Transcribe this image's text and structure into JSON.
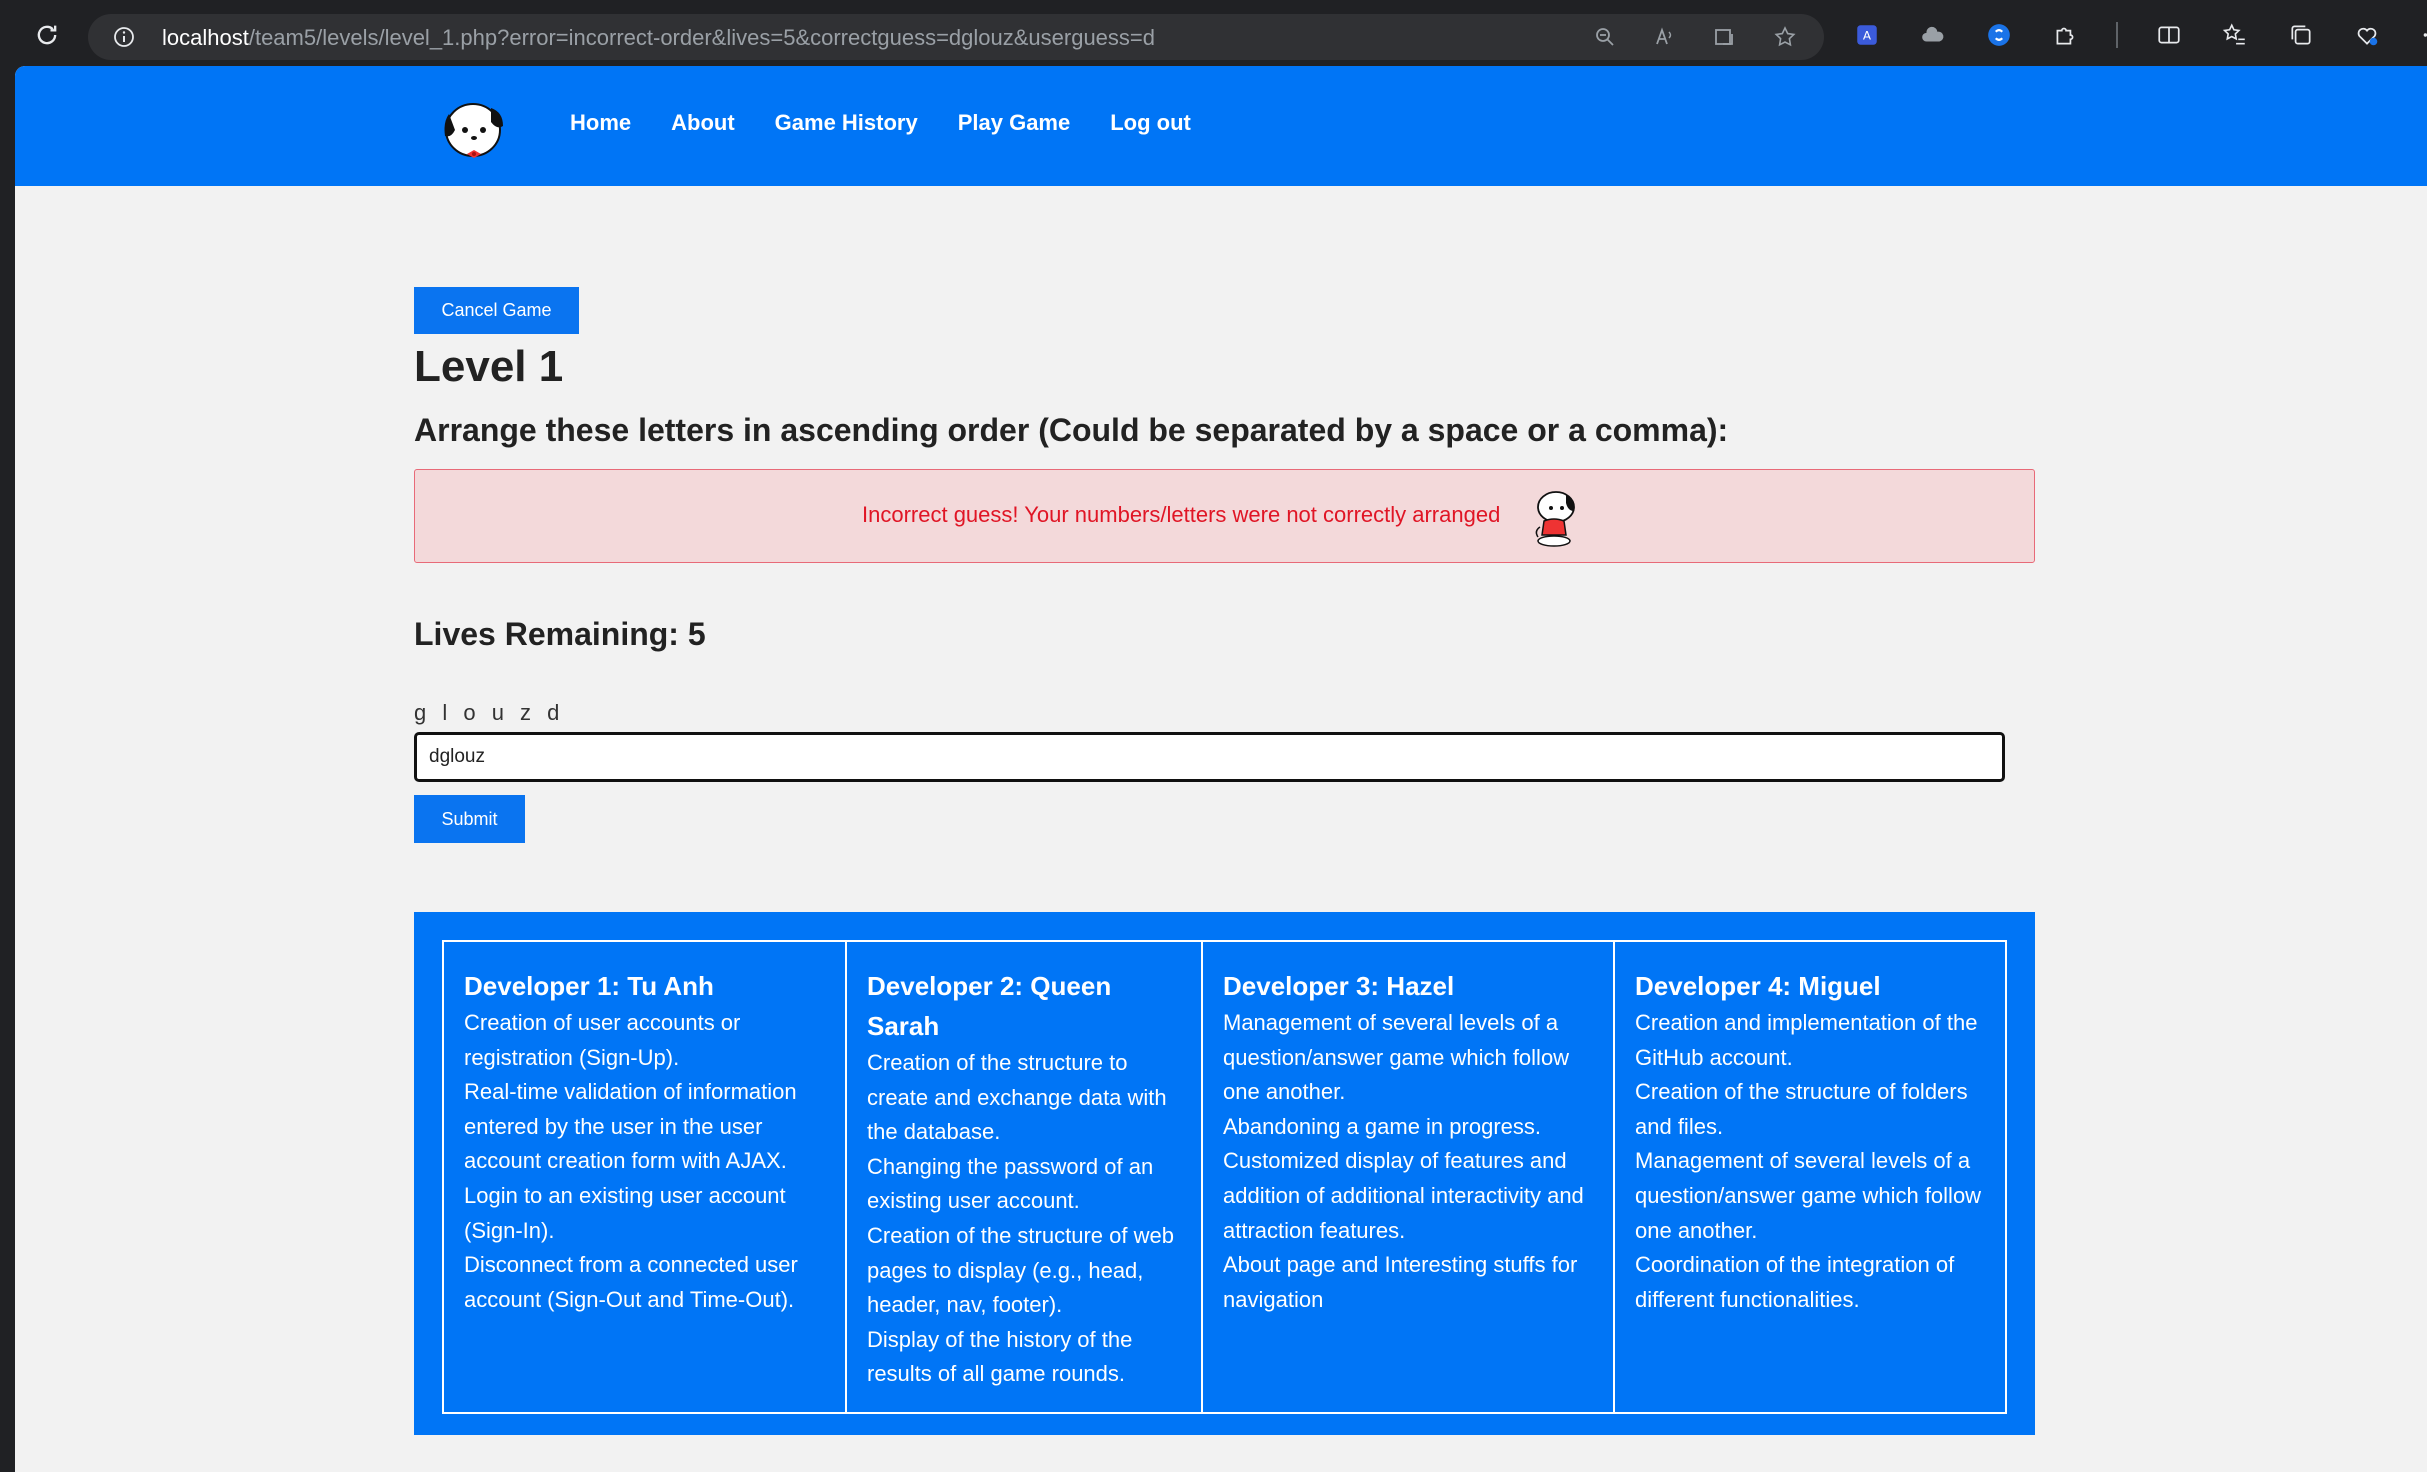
{
  "browser": {
    "url_host": "localhost",
    "url_path": "/team5/levels/level_1.php?error=incorrect-order&lives=5&correctguess=dglouz&userguess=d"
  },
  "nav": {
    "links": [
      "Home",
      "About",
      "Game History",
      "Play Game",
      "Log out"
    ]
  },
  "game": {
    "cancel_label": "Cancel Game",
    "level_title": "Level 1",
    "instructions": "Arrange these letters in ascending order (Could be separated by a space or a comma):",
    "error_message": "Incorrect guess! Your numbers/letters were not correctly arranged",
    "lives_text": "Lives Remaining: 5",
    "letters": "g l o u z d",
    "input_value": "dglouz",
    "submit_label": "Submit"
  },
  "developers": [
    {
      "name": "Developer 1: Tu Anh",
      "tasks": [
        "Creation of user accounts or",
        "registration (Sign-Up).",
        "Real-time validation of information",
        "entered by the user in the user",
        "account creation form with AJAX.",
        "Login to an existing user account",
        "(Sign-In).",
        "Disconnect from a connected user",
        "account (Sign-Out and Time-Out)."
      ]
    },
    {
      "name": "Developer 2: Queen Sarah",
      "tasks": [
        "Creation of the structure to",
        "create and exchange data with",
        "the database.",
        "Changing the password of an",
        "existing user account.",
        "Creation of the structure of web",
        "pages to display (e.g., head,",
        "header, nav, footer).",
        "Display of the history of the",
        "results of all game rounds."
      ]
    },
    {
      "name": "Developer 3: Hazel",
      "tasks": [
        "Management of several levels of a",
        "question/answer game which follow",
        "one another.",
        "Abandoning a game in progress.",
        "Customized display of features and",
        "addition of additional interactivity and",
        "attraction features.",
        "About page and Interesting stuffs for",
        "navigation"
      ]
    },
    {
      "name": "Developer 4: Miguel",
      "tasks": [
        "Creation and implementation of the",
        "GitHub account.",
        "Creation of the structure of folders",
        "and files.",
        "Management of several levels of a",
        "question/answer game which follow",
        "one another.",
        "Coordination of the integration of",
        "different functionalities."
      ]
    }
  ]
}
